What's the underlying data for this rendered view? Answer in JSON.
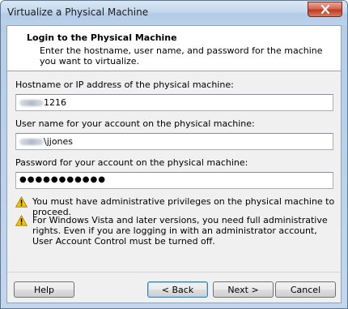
{
  "window": {
    "title": "Virtualize a Physical Machine"
  },
  "header": {
    "title": "Login to the Physical Machine",
    "description": "Enter the hostname, user name, and password for the machine you want to virtualize."
  },
  "fields": {
    "hostname": {
      "label": "Hostname or IP address of the physical machine:",
      "value": "1216"
    },
    "username": {
      "label": "User name for your account on the physical machine:",
      "value": "\\jjones"
    },
    "password": {
      "label": "Password for your account on the physical machine:",
      "value": "●●●●●●●●●●●"
    }
  },
  "warnings": [
    "You must have administrative privileges on the physical machine to proceed.",
    "For Windows Vista and later versions, you need full administrative rights. Even if you are logging in with an administrator account, User Account Control must be turned off."
  ],
  "buttons": {
    "help": "Help",
    "back": "< Back",
    "next": "Next >",
    "cancel": "Cancel"
  },
  "icons": [
    "close-icon",
    "warning-icon"
  ],
  "colors": {
    "warning": "#f5c400",
    "default_button": "#3c7fb1"
  }
}
